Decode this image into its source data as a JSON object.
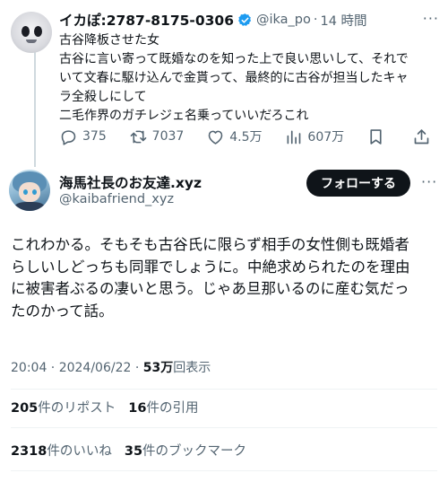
{
  "parent_tweet": {
    "author_name": "イカぽ:2787-8175-0306",
    "handle": "@ika_po",
    "separator": "·",
    "time": "14 時間",
    "more": "···",
    "lines": [
      "古谷降板させた女",
      "古谷に言い寄って既婚なのを知った上で良い思いして、それで",
      "いて文春に駆け込んで金貰って、最終的に古谷が担当したキャ",
      "ラ全殺しにして",
      "二毛作界のガチレジェ名乗っていいだろこれ"
    ],
    "actions": {
      "replies": "375",
      "retweets": "7037",
      "likes": "4.5万",
      "views": "607万"
    }
  },
  "main_tweet": {
    "author_name": "海馬社長のお友達.xyz",
    "handle": "@kaibafriend_xyz",
    "follow_label": "フォローする",
    "more": "···",
    "lines": [
      "これわかる。そもそも古谷氏に限らず相手の女性側も既婚者",
      "らしいしどっちも同罪でしょうに。中絶求められたのを理由",
      "に被害者ぶるの凄いと思う。じゃあ旦那いるのに産む気だっ",
      "たのかって話。"
    ],
    "timestamp": "20:04 · 2024/06/22 · ",
    "view_count": "53万",
    "view_label": "回表示",
    "stats": {
      "reposts_count": "205",
      "reposts_label": "件のリポスト",
      "quotes_count": "16",
      "quotes_label": "件の引用",
      "likes_count": "2318",
      "likes_label": "件のいいね",
      "bookmarks_count": "35",
      "bookmarks_label": "件のブックマーク"
    }
  },
  "colors": {
    "text": "#0f1419",
    "secondary": "#536471",
    "verified": "#1d9bf0",
    "button_bg": "#0f1419",
    "divider": "#eff3f4"
  },
  "icons": [
    "reply-icon",
    "retweet-icon",
    "like-icon",
    "views-icon",
    "bookmark-icon",
    "share-icon",
    "verified-badge-icon",
    "more-icon"
  ]
}
